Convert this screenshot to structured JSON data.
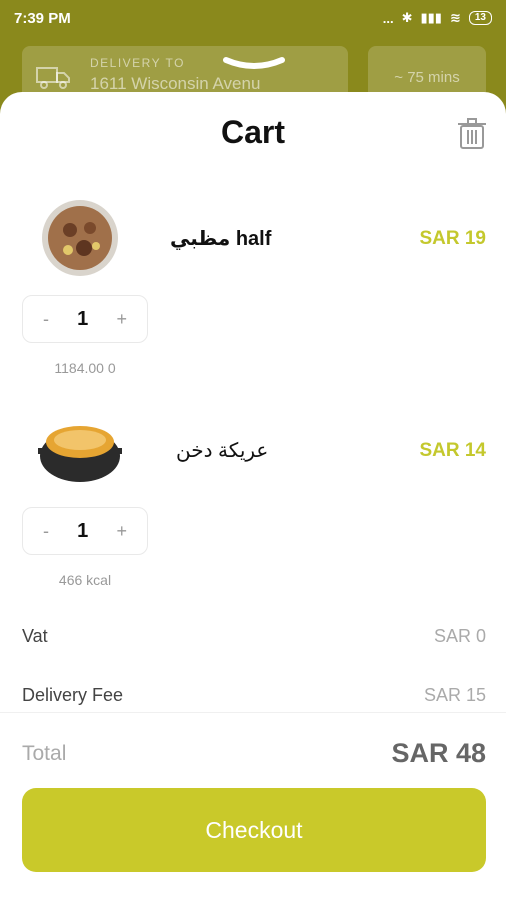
{
  "status_bar": {
    "time": "7:39 PM",
    "dots": "...",
    "bluetooth": "✱",
    "signal": "▮▮▮",
    "wifi": "≋",
    "battery": "13"
  },
  "header": {
    "delivery_label": "DELIVERY TO",
    "delivery_address": "1611 Wisconsin Avenu",
    "eta": "~ 75 mins"
  },
  "cart": {
    "title": "Cart",
    "items": [
      {
        "name": "مظبي half",
        "price": "SAR 19",
        "quantity": "1",
        "minus": "-",
        "plus": "+",
        "note": "1184.00 0"
      },
      {
        "name": "عريكة دخن",
        "price": "SAR 14",
        "quantity": "1",
        "minus": "-",
        "plus": "+",
        "note": "466 kcal"
      }
    ],
    "vat": {
      "label": "Vat",
      "value": "SAR 0"
    },
    "delivery_fee": {
      "label": "Delivery Fee",
      "value": "SAR 15"
    },
    "total": {
      "label": "Total",
      "value": "SAR 48"
    },
    "checkout_label": "Checkout"
  },
  "colors": {
    "brand": "#8a891c",
    "accent": "#c9c92a",
    "price": "#c4c82d"
  }
}
